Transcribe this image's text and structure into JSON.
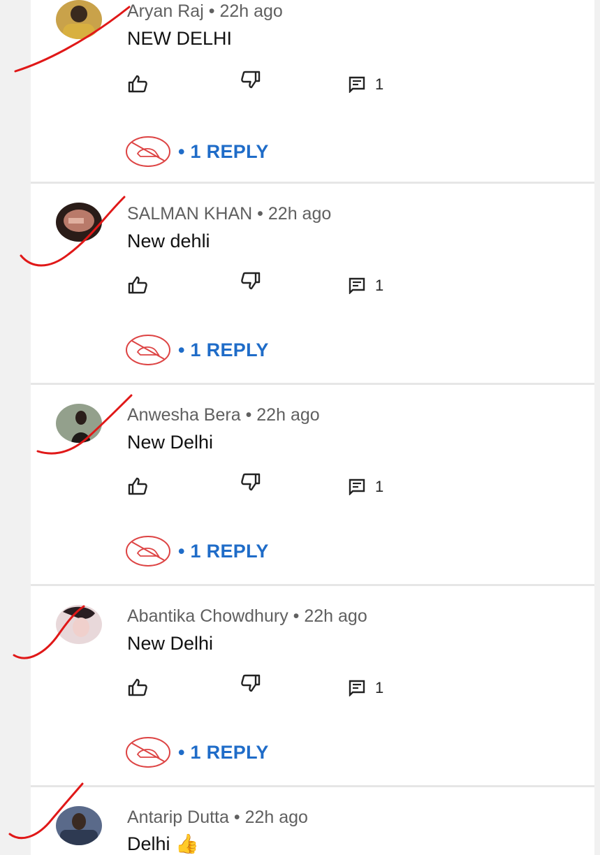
{
  "comments": [
    {
      "author": "Aryan Raj",
      "dot": "•",
      "time": "22h ago",
      "text": "NEW DELHI",
      "reply_count": "1",
      "replies_label": "• 1 REPLY",
      "avatar_color": "#c9a24a"
    },
    {
      "author": "SALMAN KHAN",
      "dot": "•",
      "time": "22h ago",
      "text": "New dehli",
      "reply_count": "1",
      "replies_label": "• 1 REPLY",
      "avatar_color": "#8a5a4a"
    },
    {
      "author": "Anwesha Bera",
      "dot": "•",
      "time": "22h ago",
      "text": "New Delhi",
      "reply_count": "1",
      "replies_label": "• 1 REPLY",
      "avatar_color": "#6b7a66"
    },
    {
      "author": "Abantika Chowdhury",
      "dot": "•",
      "time": "22h ago",
      "text": "New Delhi",
      "reply_count": "1",
      "replies_label": "• 1 REPLY",
      "avatar_color": "#d9c0c4"
    },
    {
      "author": "Antarip Dutta",
      "dot": "•",
      "time": "22h ago",
      "text": "Delhi",
      "emoji": "👍",
      "avatar_color": "#4a5a78"
    }
  ],
  "icons": {
    "like": "thumbs-up-icon",
    "dislike": "thumbs-down-icon",
    "reply": "comment-icon",
    "reply_avatar": "hidden-avatar-icon"
  },
  "colors": {
    "annotation_mark": "#e01818",
    "replies_link": "#1f6cc8",
    "meta_text": "#606060"
  }
}
